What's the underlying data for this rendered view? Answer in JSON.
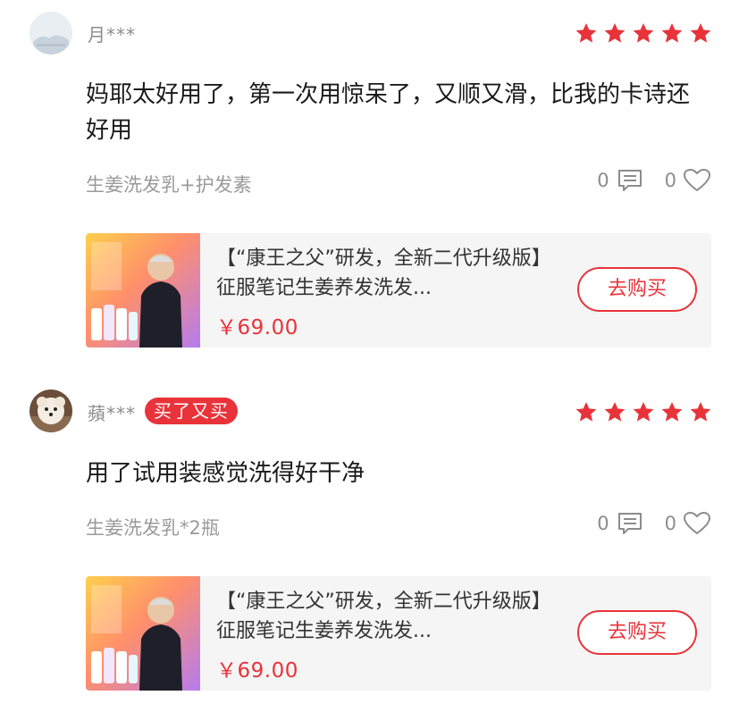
{
  "colors": {
    "accent": "#e8333a",
    "muted": "#8c8c8c",
    "card_bg": "#f5f5f5"
  },
  "reviews": [
    {
      "username": "月***",
      "badge": "",
      "rating": 5,
      "text": "妈耶太好用了，第一次用惊呆了，又顺又滑，比我的卡诗还好用",
      "variant": "生姜洗发乳+护发素",
      "comment_count": "0",
      "like_count": "0",
      "product": {
        "title": "【“康王之父”研发，全新二代升级版】征服笔记生姜养发洗发...",
        "price": "￥69.00",
        "buy_label": "去购买"
      }
    },
    {
      "username": "蘋***",
      "badge": "买了又买",
      "rating": 5,
      "text": "用了试用装感觉洗得好干净",
      "variant": "生姜洗发乳*2瓶",
      "comment_count": "0",
      "like_count": "0",
      "product": {
        "title": "【“康王之父”研发，全新二代升级版】征服笔记生姜养发洗发...",
        "price": "￥69.00",
        "buy_label": "去购买"
      }
    }
  ]
}
